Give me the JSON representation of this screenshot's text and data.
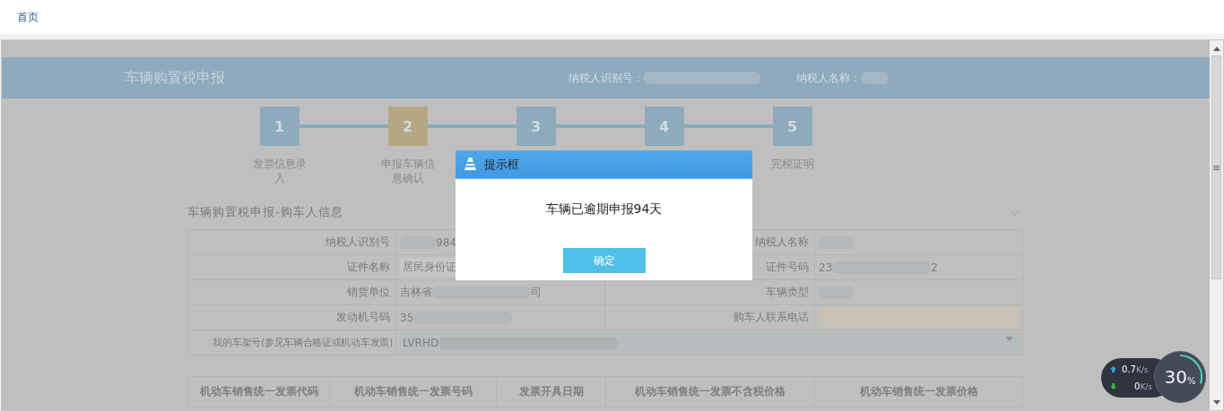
{
  "nav": {
    "home_link": "首页"
  },
  "header": {
    "title": "车辆购置税申报",
    "taxpayer_id_label": "纳税人识别号：",
    "taxpayer_name_label": "纳税人名称："
  },
  "steps": [
    {
      "number": "1",
      "label": "发票信息录入",
      "selected": false
    },
    {
      "number": "2",
      "label": "申报车辆信息确认",
      "selected": true
    },
    {
      "number": "3",
      "selected": false
    },
    {
      "number": "4",
      "selected": false
    },
    {
      "number": "5",
      "label": "完税证明",
      "selected": false
    }
  ],
  "section": {
    "title": "车辆购置税申报-购车人信息"
  },
  "form_rows": [
    {
      "fields": [
        {
          "label": "纳税人识别号",
          "kind": "text",
          "parts": [
            {
              "kind": "redacted"
            },
            {
              "kind": "text",
              "text": "984"
            }
          ]
        },
        {
          "label": "纳税人名称",
          "kind": "text",
          "parts": [
            {
              "kind": "redacted"
            }
          ]
        }
      ]
    },
    {
      "fields": [
        {
          "label": "证件名称",
          "kind": "disabled-input",
          "parts": [
            {
              "kind": "text",
              "text": "居民身份证"
            }
          ]
        },
        {
          "label": "证件号码",
          "kind": "text",
          "parts": [
            {
              "kind": "text",
              "text": "23"
            },
            {
              "kind": "redacted"
            },
            {
              "kind": "text",
              "text": "2"
            }
          ]
        }
      ]
    },
    {
      "fields": [
        {
          "label": "销货单位",
          "kind": "text",
          "parts": [
            {
              "kind": "text",
              "text": "吉林省"
            },
            {
              "kind": "redacted"
            },
            {
              "kind": "text",
              "text": "司"
            }
          ]
        },
        {
          "label": "车辆类型",
          "kind": "text",
          "parts": [
            {
              "kind": "redacted"
            }
          ]
        }
      ]
    },
    {
      "fields": [
        {
          "label": "发动机号码",
          "kind": "text",
          "parts": [
            {
              "kind": "text",
              "text": "35"
            },
            {
              "kind": "redacted"
            }
          ]
        },
        {
          "label": "购车人联系电话",
          "kind": "input"
        }
      ]
    },
    {
      "fields": [
        {
          "label": "我的车架号(参见车辆合格证或机动车发票)",
          "kind": "select",
          "parts": [
            {
              "kind": "text",
              "text": "LVRHD"
            },
            {
              "kind": "redacted"
            }
          ]
        }
      ]
    }
  ],
  "invoice_table": {
    "columns": [
      "机动车销售统一发票代码",
      "机动车销售统一发票号码",
      "发票开具日期",
      "机动车销售统一发票不含税价格",
      "机动车销售统一发票价格"
    ]
  },
  "dialog": {
    "title": "提示框",
    "message": "车辆已逾期申报94天",
    "button": "确定"
  },
  "net_widget": {
    "upload": "0.7",
    "upload_unit": "K/s",
    "download": "0",
    "download_unit": "K/s",
    "percent": "30",
    "percent_sign": "%"
  }
}
